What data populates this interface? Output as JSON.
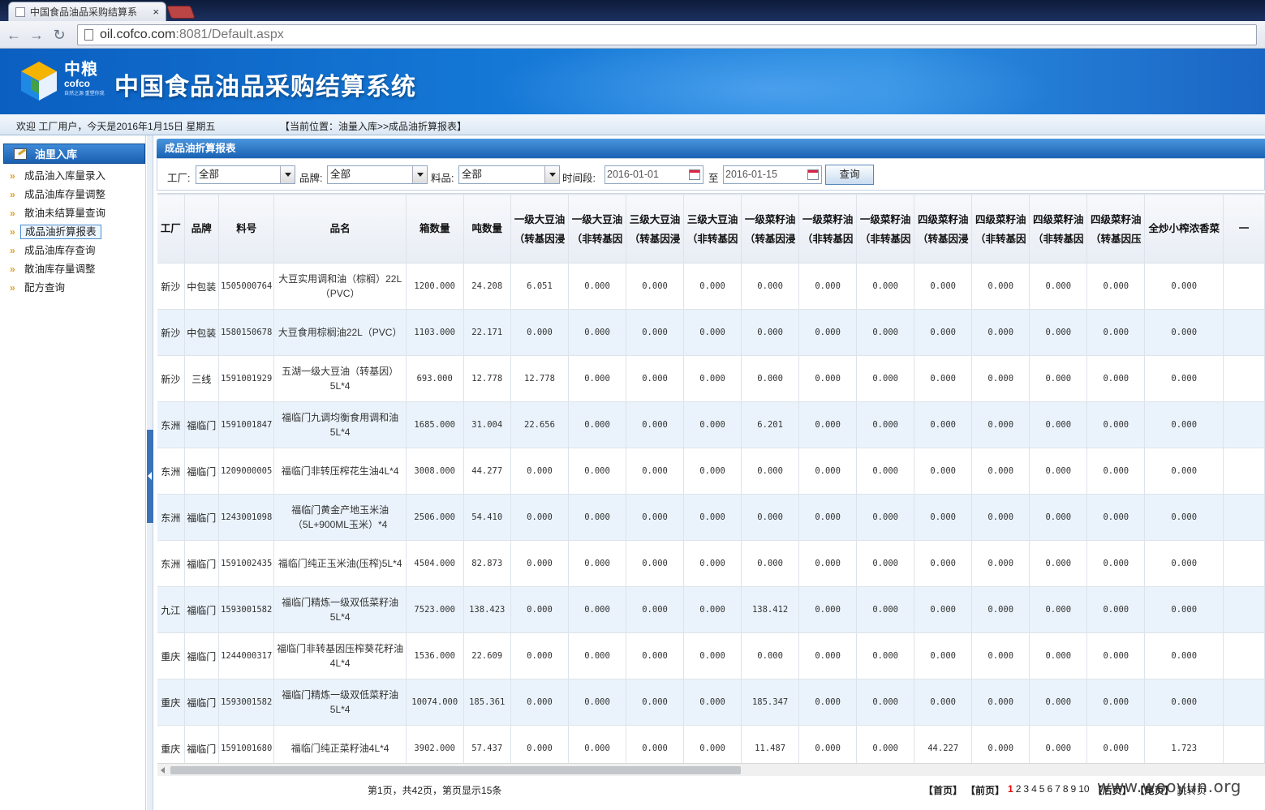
{
  "browser": {
    "tab_title": "中国食品油品采购结算系",
    "tab_close": "×",
    "url_host": "oil.cofco.com",
    "url_path": ":8081/Default.aspx"
  },
  "banner": {
    "logo_cn": "中粮",
    "logo_en": "cofco",
    "logo_tag": "自然之源 重塑你我",
    "title": "中国食品油品采购结算系统"
  },
  "status": {
    "welcome": "欢迎  工厂用户，今天是2016年1月15日  星期五",
    "location": "【当前位置：油量入库>>成品油折算报表】"
  },
  "sidebar": {
    "header": "油里入库",
    "items": [
      {
        "label": "成品油入库量录入"
      },
      {
        "label": "成品油库存量调整"
      },
      {
        "label": "散油未结算量查询"
      },
      {
        "label": "成品油折算报表"
      },
      {
        "label": "成品油库存查询"
      },
      {
        "label": "散油库存量调整"
      },
      {
        "label": "配方查询"
      }
    ]
  },
  "panel": {
    "title": "成品油折算报表"
  },
  "filters": {
    "factory_label": "工厂:",
    "factory_value": "全部",
    "brand_label": "品牌:",
    "brand_value": "全部",
    "material_label": "料品:",
    "material_value": "全部",
    "period_label": "时间段:",
    "date_from": "2016-01-01",
    "to_label": "至",
    "date_to": "2016-01-15",
    "query_button": "查询"
  },
  "table": {
    "columns": [
      {
        "h1": "工厂",
        "h2": ""
      },
      {
        "h1": "品牌",
        "h2": ""
      },
      {
        "h1": "料号",
        "h2": ""
      },
      {
        "h1": "品名",
        "h2": ""
      },
      {
        "h1": "箱数量",
        "h2": ""
      },
      {
        "h1": "吨数量",
        "h2": ""
      },
      {
        "h1": "一级大豆油",
        "h2": "（转基因浸"
      },
      {
        "h1": "一级大豆油",
        "h2": "（非转基因"
      },
      {
        "h1": "三级大豆油",
        "h2": "（转基因浸"
      },
      {
        "h1": "三级大豆油",
        "h2": "（非转基因"
      },
      {
        "h1": "一级菜籽油",
        "h2": "（转基因浸"
      },
      {
        "h1": "一级菜籽油",
        "h2": "（非转基因"
      },
      {
        "h1": "一级菜籽油",
        "h2": "（非转基因"
      },
      {
        "h1": "四级菜籽油",
        "h2": "（转基因浸"
      },
      {
        "h1": "四级菜籽油",
        "h2": "（非转基因"
      },
      {
        "h1": "四级菜籽油",
        "h2": "（非转基因"
      },
      {
        "h1": "四级菜籽油",
        "h2": "（转基因压"
      },
      {
        "h1": "全炒小榨浓香菜",
        "h2": ""
      },
      {
        "h1": "一",
        "h2": ""
      }
    ],
    "rows": [
      [
        "新沙",
        "中包装",
        "1505000764",
        "大豆实用调和油（棕榈）22L（PVC）",
        "1200.000",
        "24.208",
        "6.051",
        "0.000",
        "0.000",
        "0.000",
        "0.000",
        "0.000",
        "0.000",
        "0.000",
        "0.000",
        "0.000",
        "0.000",
        "0.000",
        ""
      ],
      [
        "新沙",
        "中包装",
        "1580150678",
        "大豆食用棕榈油22L（PVC）",
        "1103.000",
        "22.171",
        "0.000",
        "0.000",
        "0.000",
        "0.000",
        "0.000",
        "0.000",
        "0.000",
        "0.000",
        "0.000",
        "0.000",
        "0.000",
        "0.000",
        ""
      ],
      [
        "新沙",
        "三线",
        "1591001929",
        "五湖一级大豆油（转基因）5L*4",
        "693.000",
        "12.778",
        "12.778",
        "0.000",
        "0.000",
        "0.000",
        "0.000",
        "0.000",
        "0.000",
        "0.000",
        "0.000",
        "0.000",
        "0.000",
        "0.000",
        ""
      ],
      [
        "东洲",
        "福临门",
        "1591001847",
        "福临门九调均衡食用调和油5L*4",
        "1685.000",
        "31.004",
        "22.656",
        "0.000",
        "0.000",
        "0.000",
        "6.201",
        "0.000",
        "0.000",
        "0.000",
        "0.000",
        "0.000",
        "0.000",
        "0.000",
        ""
      ],
      [
        "东洲",
        "福临门",
        "1209000005",
        "福临门非转压榨花生油4L*4",
        "3008.000",
        "44.277",
        "0.000",
        "0.000",
        "0.000",
        "0.000",
        "0.000",
        "0.000",
        "0.000",
        "0.000",
        "0.000",
        "0.000",
        "0.000",
        "0.000",
        ""
      ],
      [
        "东洲",
        "福临门",
        "1243001098",
        "福临门黄金产地玉米油（5L+900ML玉米）*4",
        "2506.000",
        "54.410",
        "0.000",
        "0.000",
        "0.000",
        "0.000",
        "0.000",
        "0.000",
        "0.000",
        "0.000",
        "0.000",
        "0.000",
        "0.000",
        "0.000",
        ""
      ],
      [
        "东洲",
        "福临门",
        "1591002435",
        "福临门纯正玉米油(压榨)5L*4",
        "4504.000",
        "82.873",
        "0.000",
        "0.000",
        "0.000",
        "0.000",
        "0.000",
        "0.000",
        "0.000",
        "0.000",
        "0.000",
        "0.000",
        "0.000",
        "0.000",
        ""
      ],
      [
        "九江",
        "福临门",
        "1593001582",
        "福临门精炼一级双低菜籽油5L*4",
        "7523.000",
        "138.423",
        "0.000",
        "0.000",
        "0.000",
        "0.000",
        "138.412",
        "0.000",
        "0.000",
        "0.000",
        "0.000",
        "0.000",
        "0.000",
        "0.000",
        ""
      ],
      [
        "重庆",
        "福临门",
        "1244000317",
        "福临门非转基因压榨葵花籽油4L*4",
        "1536.000",
        "22.609",
        "0.000",
        "0.000",
        "0.000",
        "0.000",
        "0.000",
        "0.000",
        "0.000",
        "0.000",
        "0.000",
        "0.000",
        "0.000",
        "0.000",
        ""
      ],
      [
        "重庆",
        "福临门",
        "1593001582",
        "福临门精炼一级双低菜籽油5L*4",
        "10074.000",
        "185.361",
        "0.000",
        "0.000",
        "0.000",
        "0.000",
        "185.347",
        "0.000",
        "0.000",
        "0.000",
        "0.000",
        "0.000",
        "0.000",
        "0.000",
        ""
      ],
      [
        "重庆",
        "福临门",
        "1591001680",
        "福临门纯正菜籽油4L*4",
        "3902.000",
        "57.437",
        "0.000",
        "0.000",
        "0.000",
        "0.000",
        "11.487",
        "0.000",
        "0.000",
        "44.227",
        "0.000",
        "0.000",
        "0.000",
        "1.723",
        ""
      ]
    ]
  },
  "pager": {
    "info": "第1页，共42页，第页显示15条",
    "first": "【首页】",
    "prev": "【前页】",
    "pages": [
      "1",
      "2",
      "3",
      "4",
      "5",
      "6",
      "7",
      "8",
      "9",
      "10"
    ],
    "next": "【后页】",
    "last": "【尾页】",
    "jump": "跳转页"
  },
  "watermark": "www.wooyun.org",
  "colors": {
    "accent": "#1a62b3",
    "current_page": "#e00000",
    "alt_row": "#eaf3fb"
  }
}
